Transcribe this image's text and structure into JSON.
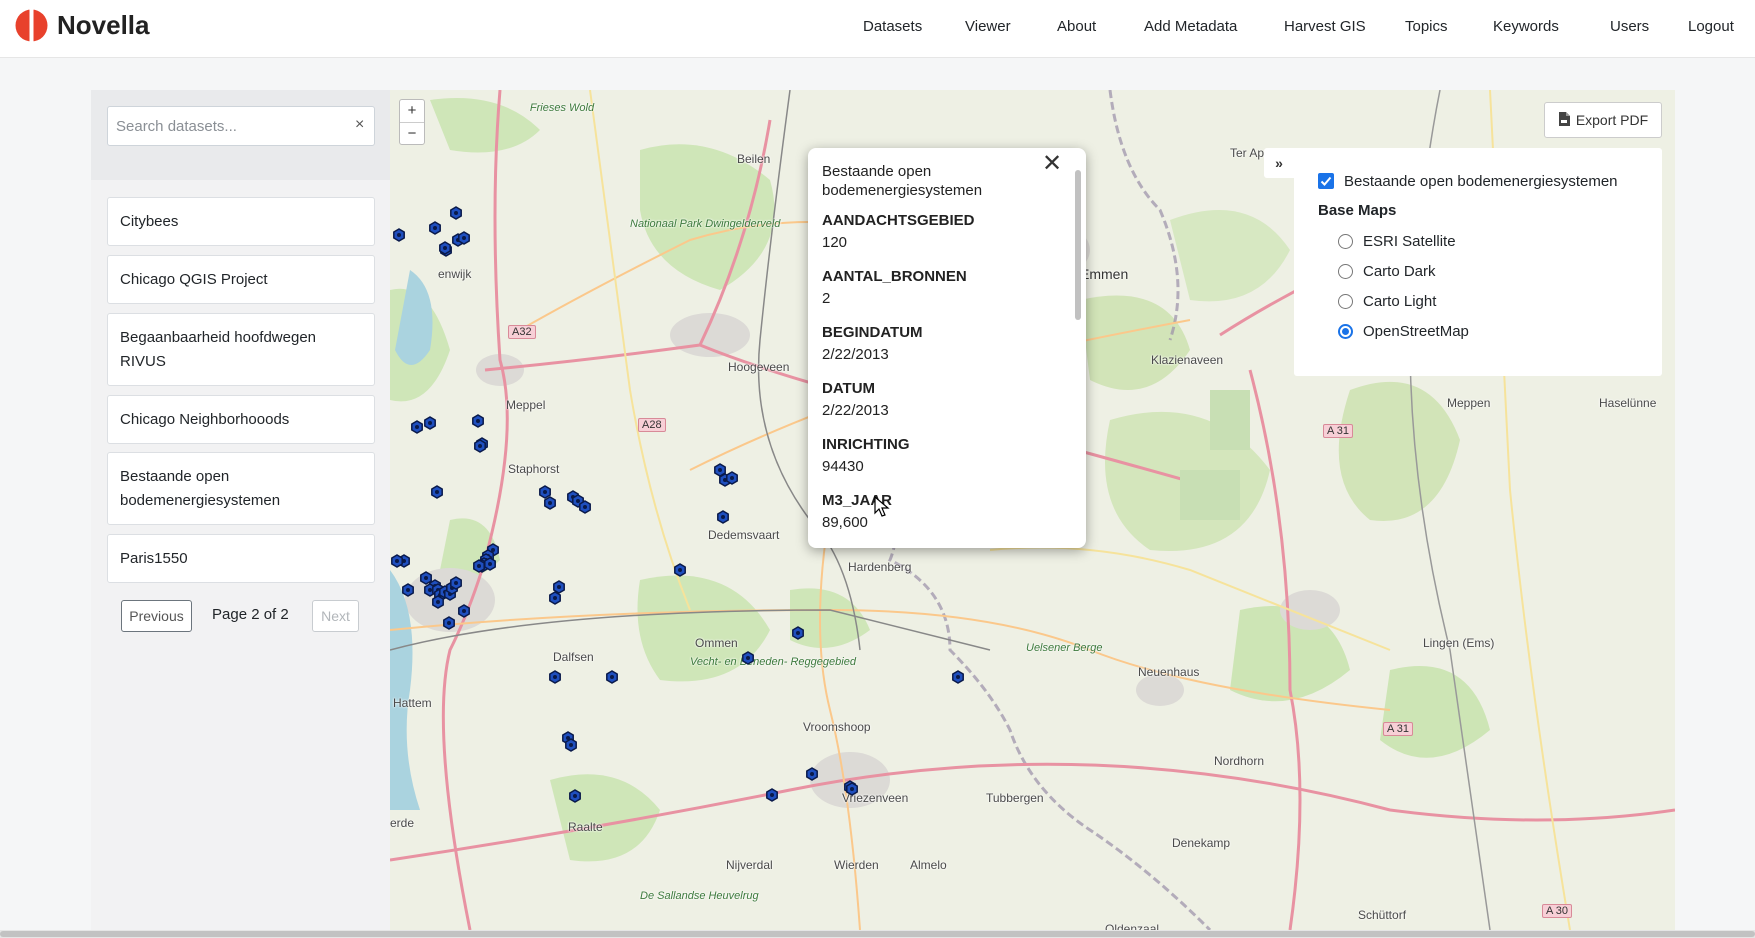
{
  "brand": {
    "name": "Novella"
  },
  "nav": {
    "datasets": "Datasets",
    "viewer": "Viewer",
    "about": "About",
    "add_metadata": "Add Metadata",
    "harvest_gis": "Harvest GIS",
    "topics": "Topics",
    "keywords": "Keywords",
    "users": "Users",
    "logout": "Logout"
  },
  "sidebar": {
    "search_placeholder": "Search datasets...",
    "clear_symbol": "×",
    "datasets": [
      "Citybees",
      "Chicago QGIS Project",
      "Begaanbaarheid hoofdwegen RIVUS",
      "Chicago Neighborhooods",
      "Bestaande open bodemenergiesystemen",
      "Paris1550"
    ],
    "pager": {
      "previous": "Previous",
      "status": "Page 2 of 2",
      "next": "Next"
    }
  },
  "map": {
    "zoom_in": "+",
    "zoom_out": "−",
    "export_label": "Export PDF",
    "layer_toggle": "»",
    "layers": {
      "overlay_label": "Bestaande open bodemenergiesystemen",
      "overlay_checked": true,
      "base_maps_title": "Base Maps",
      "base_maps": [
        "ESRI Satellite",
        "Carto Dark",
        "Carto Light",
        "OpenStreetMap"
      ],
      "selected_base_map": "OpenStreetMap"
    },
    "popup": {
      "title": "Bestaande open bodemenergiesystemen",
      "close_symbol": "✕",
      "fields": [
        {
          "key": "AANDACHTSGEBIED",
          "value": "120"
        },
        {
          "key": "AANTAL_BRONNEN",
          "value": "2"
        },
        {
          "key": "BEGINDATUM",
          "value": "2/22/2013"
        },
        {
          "key": "DATUM",
          "value": "2/22/2013"
        },
        {
          "key": "INRICHTING",
          "value": "94430"
        },
        {
          "key": "M3_JAAR",
          "value": "89,600"
        }
      ]
    },
    "labels": {
      "beilen": "Beilen",
      "nationaal_park": "Nationaal Park Dwingelderveld",
      "emmen": "Emmen",
      "klazienaveen": "Klazienaveen",
      "ter_ap": "Ter Ap",
      "hoogeveen": "Hoogeveen",
      "meppel": "Meppel",
      "staphorst": "Staphorst",
      "zwartewolde": "Frieses Wold",
      "dedemsvaart": "Dedemsvaart",
      "hardenberg": "Hardenberg",
      "ommen": "Ommen",
      "dalfsen": "Dalfsen",
      "hattem": "Hattem",
      "vecht": "Vecht- en Beneden- Reggegebied",
      "vroomshoop": "Vroomshoop",
      "vriezenveen": "Vriezenveen",
      "tubbergen": "Tubbergen",
      "uelsener": "Uelsener Berge",
      "neuenhaus": "Neuenhaus",
      "nordhorn": "Nordhorn",
      "denekamp": "Denekamp",
      "lingen": "Lingen (Ems)",
      "meppen": "Meppen",
      "haselunne": "Haselünne",
      "raalte": "Raalte",
      "nijverdal": "Nijverdal",
      "wierden": "Wierden",
      "almelo": "Almelo",
      "sallandse": "De Sallandse Heuvelrug",
      "schuttorf": "Schüttorf",
      "oldenzaal": "Oldenzaal",
      "zwolle_left": "erde",
      "genemuiden": "enwijk",
      "a32": "A32",
      "a28": "A28",
      "a31a": "A 31",
      "a31b": "A 31",
      "a30": "A 30"
    }
  }
}
